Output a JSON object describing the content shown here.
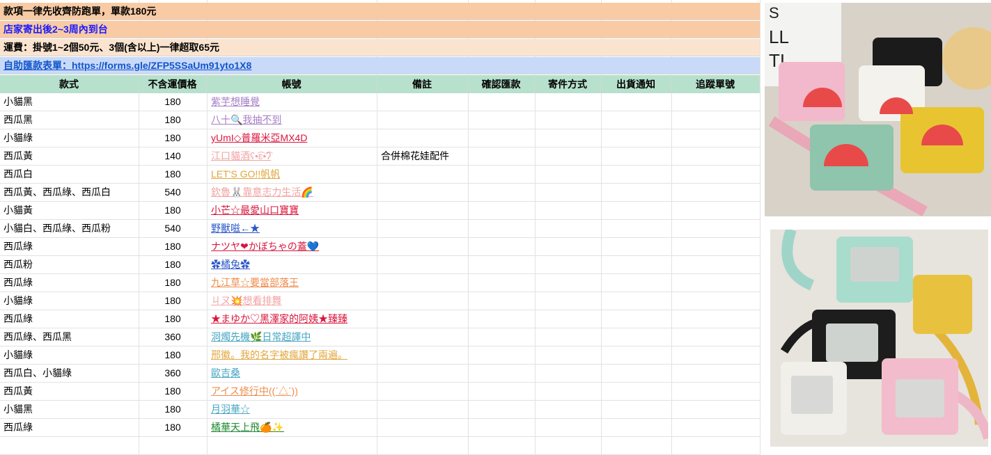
{
  "banners": {
    "line1": "款項一律先收齊防跑單，單款180元",
    "line2": "店家寄出後2~3周內到台",
    "line3": "運費：掛號1~2個50元、3個(含以上)一律超取65元",
    "line4_prefix": "自助匯款表單：",
    "line4_link": "https://forms.gle/ZFP5SSaUm91yto1X8"
  },
  "headers": [
    "款式",
    "不含運價格",
    "帳號",
    "備註",
    "確認匯款",
    "寄件方式",
    "出貨通知",
    "追蹤單號"
  ],
  "rows": [
    {
      "style": "小貓黑",
      "price": "180",
      "account": "紫芋想睡覺",
      "note": "",
      "color": "#a77fc6"
    },
    {
      "style": "西瓜黑",
      "price": "180",
      "account": "八十🔍我抽不到",
      "note": "",
      "color": "#a77fc6"
    },
    {
      "style": "小貓綠",
      "price": "180",
      "account": "yUmI◇普羅米亞MX4D",
      "note": "",
      "color": "#d9163d"
    },
    {
      "style": "西瓜黃",
      "price": "140",
      "account": "江口貓酒ʕ•͡ɛ•͡ʔ",
      "note": "合併棉花娃配件",
      "color": "#f2a3a3"
    },
    {
      "style": "西瓜白",
      "price": "180",
      "account": "LET'S GO!!帆帆",
      "note": "",
      "color": "#e1a63c"
    },
    {
      "style": "西瓜黃、西瓜綠、西瓜白",
      "price": "540",
      "account": "欽魯🐰靠意志力生活🌈",
      "note": "",
      "color": "#f2a3a3"
    },
    {
      "style": "小貓黃",
      "price": "180",
      "account": "小芒☆最愛山口寶寶",
      "note": "",
      "color": "#d9163d"
    },
    {
      "style": "小貓白、西瓜綠、西瓜粉",
      "price": "540",
      "account": "野獸嗞←★",
      "note": "",
      "color": "#2b57c9"
    },
    {
      "style": "西瓜綠",
      "price": "180",
      "account": "ナツヤ❤かぼちゃの蓋💙",
      "note": "",
      "color": "#d9163d"
    },
    {
      "style": "西瓜粉",
      "price": "180",
      "account": "✿橘兔✿",
      "note": "",
      "color": "#2b57c9"
    },
    {
      "style": "西瓜綠",
      "price": "180",
      "account": "九江草☆要當部落王",
      "note": "",
      "color": "#ee8b4a"
    },
    {
      "style": "小貓綠",
      "price": "180",
      "account": "ㄐㄡ💥想看排舞",
      "note": "",
      "color": "#f2a3a3"
    },
    {
      "style": "西瓜綠",
      "price": "180",
      "account": "★まゆか♡黑澤家的阿姨★臻臻",
      "note": "",
      "color": "#d9163d"
    },
    {
      "style": "西瓜綠、西瓜黑",
      "price": "360",
      "account": "洞燭先機🌿日常超譯中",
      "note": "",
      "color": "#45a5c2"
    },
    {
      "style": "小貓綠",
      "price": "180",
      "account": "邢徽。我的名字被瘋讚了兩遍。",
      "note": "",
      "color": "#e1a63c"
    },
    {
      "style": "西瓜白、小貓綠",
      "price": "360",
      "account": "歐吉桑",
      "note": "",
      "color": "#45a5c2"
    },
    {
      "style": "西瓜黃",
      "price": "180",
      "account": "アイス修行中((ˊ△ˋ))",
      "note": "",
      "color": "#ee8b4a"
    },
    {
      "style": "小貓黑",
      "price": "180",
      "account": "月羽華☆",
      "note": "",
      "color": "#45a5c2"
    },
    {
      "style": "西瓜綠",
      "price": "180",
      "account": "橘華天上飛🍊✨",
      "note": "",
      "color": "#1d8a2e"
    }
  ]
}
